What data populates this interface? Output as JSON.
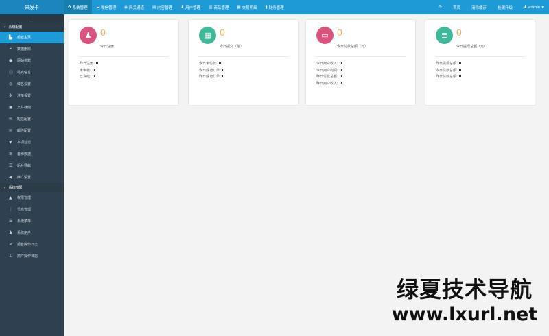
{
  "app": {
    "title": "来发卡"
  },
  "topnav": [
    {
      "icon": "gear-icon",
      "glyph": "✿",
      "label": "系统管理",
      "active": true
    },
    {
      "icon": "wechat-icon",
      "glyph": "☁",
      "label": "微信管理"
    },
    {
      "icon": "gateway-icon",
      "glyph": "◉",
      "label": "网关通道"
    },
    {
      "icon": "document-icon",
      "glyph": "▤",
      "label": "内容管理"
    },
    {
      "icon": "users-icon",
      "glyph": "♟",
      "label": "用户管理"
    },
    {
      "icon": "shop-icon",
      "glyph": "▥",
      "label": "商品管理"
    },
    {
      "icon": "chart-icon",
      "glyph": "▦",
      "label": "交易明细"
    },
    {
      "icon": "finance-icon",
      "glyph": "▮",
      "label": "财务管理"
    }
  ],
  "topright": {
    "refresh_glyph": "⟳",
    "home": "首页",
    "clear_cache": "清除缓存",
    "check_update": "检测升级",
    "user_glyph": "♟",
    "user": "admin",
    "user_caret": "▾"
  },
  "sidebar": {
    "toggle_glyph": "⁞",
    "groups": [
      {
        "label": "系统配置",
        "items": [
          {
            "label": "后台主页",
            "icon": "bar-chart-icon",
            "glyph": "▙",
            "active": true
          },
          {
            "label": "数据删除",
            "icon": "link-icon",
            "glyph": "⚭"
          },
          {
            "label": "网站参数",
            "icon": "apple-icon",
            "glyph": "●"
          },
          {
            "label": "站点信息",
            "icon": "info-icon",
            "glyph": "ⓘ"
          },
          {
            "label": "域名设置",
            "icon": "globe-icon",
            "glyph": "◎"
          },
          {
            "label": "注册设置",
            "icon": "gear-icon",
            "glyph": "✲"
          },
          {
            "label": "文件存储",
            "icon": "save-icon",
            "glyph": "▣"
          },
          {
            "label": "短信配置",
            "icon": "envelope-icon",
            "glyph": "✉"
          },
          {
            "label": "邮件配置",
            "icon": "envelope-icon",
            "glyph": "✉"
          },
          {
            "label": "字词过滤",
            "icon": "filter-icon",
            "glyph": "▼"
          },
          {
            "label": "备份数据",
            "icon": "database-icon",
            "glyph": "≣"
          },
          {
            "label": "后台导航",
            "icon": "list-icon",
            "glyph": "☰"
          },
          {
            "label": "推广设置",
            "icon": "bullhorn-icon",
            "glyph": "◀"
          }
        ]
      },
      {
        "label": "系统权限",
        "items": [
          {
            "label": "权限管理",
            "icon": "lock-icon",
            "glyph": "▲"
          },
          {
            "label": "节点管理",
            "icon": "node-icon",
            "glyph": "⋮"
          },
          {
            "label": "系统菜单",
            "icon": "menu-icon",
            "glyph": "☰"
          },
          {
            "label": "系统用户",
            "icon": "users-icon",
            "glyph": "♟"
          },
          {
            "label": "后台操作日志",
            "icon": "terminal-icon",
            "glyph": "≥"
          },
          {
            "label": "商户操作日志",
            "icon": "pin-icon",
            "glyph": "⊥"
          }
        ]
      }
    ]
  },
  "cards": [
    {
      "icon": "users-icon",
      "glyph": "♟",
      "color": "#d9537c",
      "value": "0",
      "title": "今日注册",
      "stats": [
        {
          "label": "昨日注册:",
          "value": "0"
        },
        {
          "label": "未审核:",
          "value": "0"
        },
        {
          "label": "已冻结:",
          "value": "0"
        }
      ]
    },
    {
      "icon": "calendar-icon",
      "glyph": "▦",
      "color": "#3fb99a",
      "value": "0",
      "title": "今日提交（笔）",
      "stats": [
        {
          "label": "今日未付款:",
          "value": "0"
        },
        {
          "label": "今日成功订单:",
          "value": "0"
        },
        {
          "label": "昨日成功订单:",
          "value": "0"
        }
      ]
    },
    {
      "icon": "credit-card-icon",
      "glyph": "▭",
      "color": "#d9537c",
      "value": "0",
      "title": "今日付款总额（元）",
      "stats": [
        {
          "label": "今日用户收入:",
          "value": "0"
        },
        {
          "label": "今日用户利润:",
          "value": "0"
        },
        {
          "label": "昨日付款总额:",
          "value": "0"
        },
        {
          "label": "昨日用户收入:",
          "value": "0"
        }
      ]
    },
    {
      "icon": "database-icon",
      "glyph": "≣",
      "color": "#3fb99a",
      "value": "0",
      "title": "今日提现总额（元）",
      "stats": [
        {
          "label": "昨日提现总额:",
          "value": "0"
        },
        {
          "label": "今日付款总额:",
          "value": "0"
        },
        {
          "label": "昨日付款总额:",
          "value": "0"
        }
      ]
    }
  ],
  "watermark": {
    "line1": "绿夏技术导航",
    "line2": "www.lxurl.net"
  }
}
